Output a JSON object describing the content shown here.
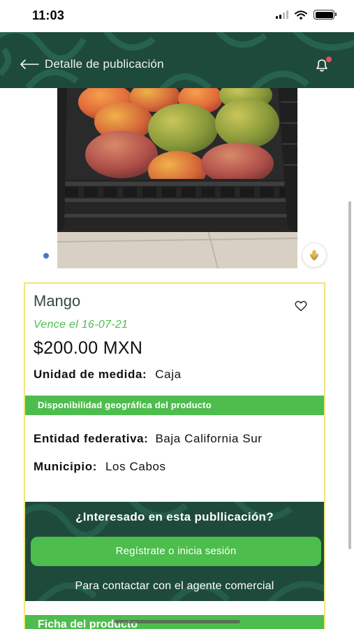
{
  "status_bar": {
    "time": "11:03"
  },
  "header": {
    "title": "Detalle de publicación"
  },
  "product": {
    "name": "Mango",
    "expires": "Vence el 16-07-21",
    "price": "$200.00 MXN",
    "unit_label": "Unidad de medida:",
    "unit_value": "Caja"
  },
  "geo": {
    "section_title": "Disponibilidad geográfica del producto",
    "entity_label": "Entidad federativa:",
    "entity_value": "Baja California Sur",
    "municipality_label": "Municipio:",
    "municipality_value": "Los Cabos"
  },
  "cta": {
    "question": "¿Interesado en esta publlicación?",
    "button_label": "Regístrate o inicia sesión",
    "note": "Para contactar con el agente comercial"
  },
  "ficha": {
    "title": "Ficha del producto"
  },
  "colors": {
    "header_bg": "#1e4a3c",
    "accent_green": "#4dbd4d",
    "expires_green": "#4fbf4f",
    "card_border": "#efe67a",
    "notification_dot": "#e65151",
    "carousel_dot": "#4b72d6"
  },
  "icons": [
    "back-arrow-icon",
    "bell-icon",
    "heart-icon",
    "corn-icon"
  ]
}
